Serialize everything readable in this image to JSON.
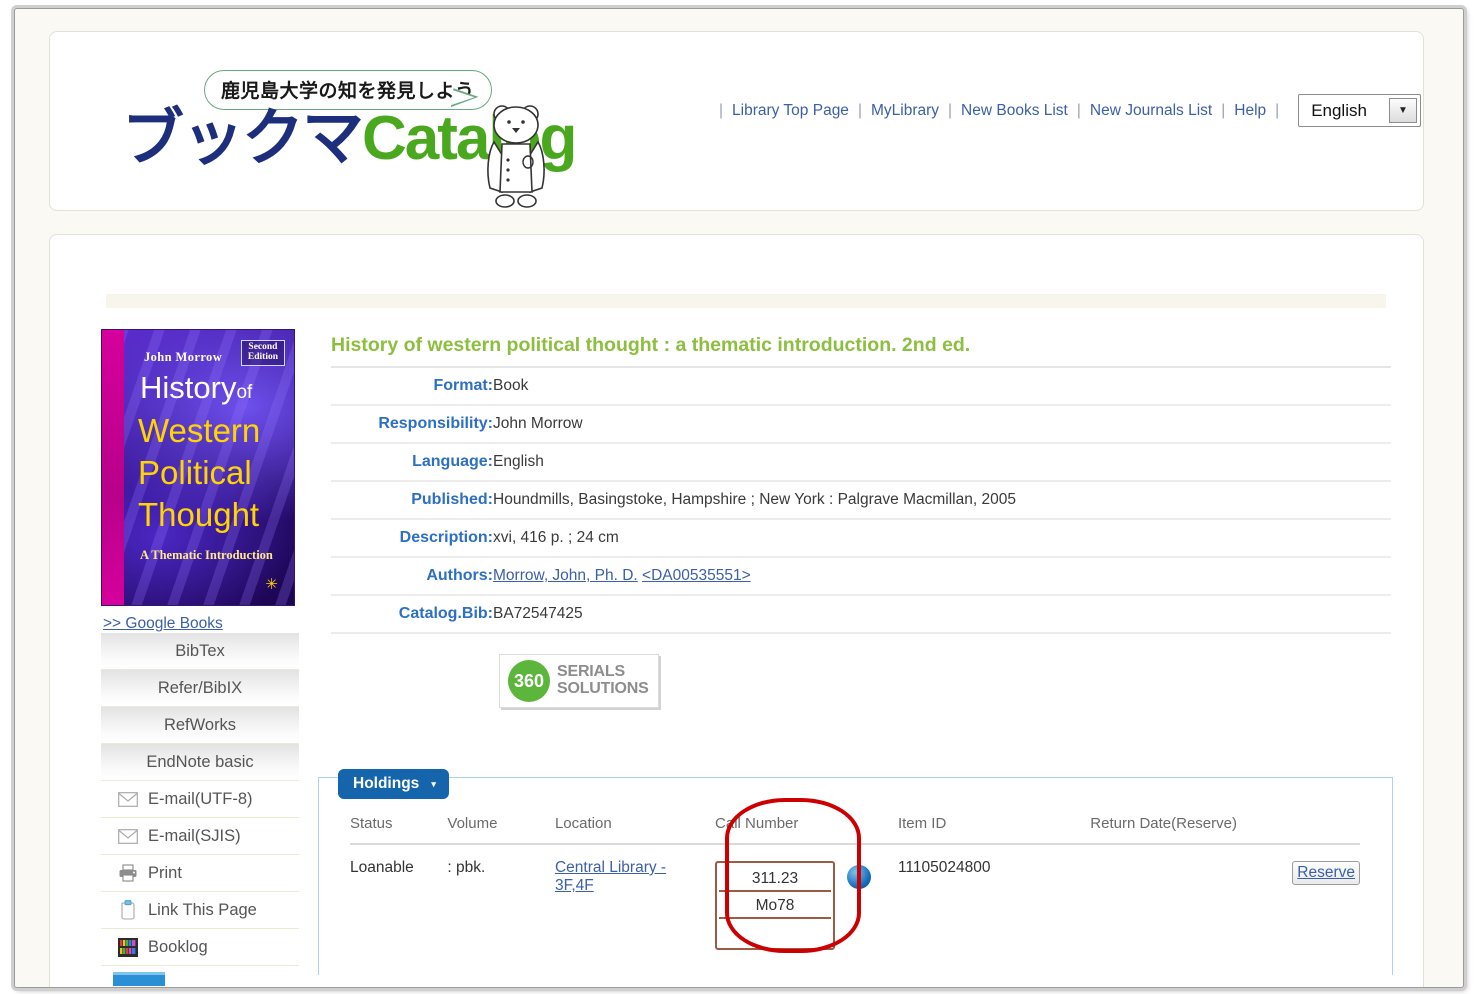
{
  "header": {
    "tagline": "鹿児島大学の知を発見しよう",
    "wordmark_jp": "ブックマ",
    "wordmark_en": "Catalog",
    "mascot_icon": "bear-mascot-icon",
    "nav": [
      {
        "label": "Library Top Page"
      },
      {
        "label": "MyLibrary"
      },
      {
        "label": "New Books List"
      },
      {
        "label": "New Journals List"
      },
      {
        "label": "Help"
      }
    ],
    "separator": "|",
    "language": {
      "selected": "English",
      "caret": "▼"
    }
  },
  "sidebar": {
    "cover": {
      "author": "John Morrow",
      "edition_line1": "Second",
      "edition_line2": "Edition",
      "title_main": "History",
      "title_of": "of",
      "title_l1": "Western",
      "title_l2": "Political",
      "title_l3": "Thought",
      "subtitle": "A Thematic Introduction",
      "publisher_mark": "✳"
    },
    "google_books_label": ">> Google Books",
    "export_buttons": [
      {
        "label": "BibTex"
      },
      {
        "label": "Refer/BibIX"
      },
      {
        "label": "RefWorks"
      },
      {
        "label": "EndNote basic"
      }
    ],
    "action_rows": [
      {
        "label": "E-mail(UTF-8)",
        "icon": "envelope-icon"
      },
      {
        "label": "E-mail(SJIS)",
        "icon": "envelope-icon"
      },
      {
        "label": "Print",
        "icon": "printer-icon"
      },
      {
        "label": "Link This Page",
        "icon": "clipboard-link-icon"
      },
      {
        "label": "Booklog",
        "icon": "bookshelf-icon"
      }
    ]
  },
  "record": {
    "title": "History of western political thought : a thematic introduction. 2nd ed.",
    "fields": [
      {
        "label": "Format:",
        "value": "Book",
        "link": false
      },
      {
        "label": "Responsibility:",
        "value": "John Morrow",
        "link": false
      },
      {
        "label": "Language:",
        "value": "English",
        "link": false
      },
      {
        "label": "Published:",
        "value": "Houndmills, Basingstoke, Hampshire ; New York : Palgrave Macmillan, 2005",
        "link": false
      },
      {
        "label": "Description:",
        "value": "xvi, 416 p. ; 24 cm",
        "link": false
      },
      {
        "label": "Authors:",
        "value": "Morrow, John, Ph. D.",
        "value2": "<DA00535551>",
        "link": true
      },
      {
        "label": "Catalog.Bib:",
        "value": "BA72547425",
        "link": false
      }
    ],
    "serials_logo": {
      "badge": "360",
      "line1": "SERIALS",
      "line2": "SOLUTIONS"
    }
  },
  "holdings": {
    "tab_label": "Holdings",
    "tab_caret": "▾",
    "columns": [
      "Status",
      "Volume",
      "Location",
      "Call Number",
      "Item ID",
      "Return Date(Reserve)"
    ],
    "rows": [
      {
        "status": "Loanable",
        "volume": ": pbk.",
        "location_line1": "Central Library -",
        "location_line2": "3F,4F",
        "call_number_lines": [
          "311.23",
          "Mo78",
          ""
        ],
        "info_icon": "info-icon",
        "info_glyph": "i",
        "item_id": "11105024800",
        "return_date": "",
        "reserve_label": "Reserve"
      }
    ]
  },
  "annotation": {
    "shape": "red-oval-highlight",
    "color": "#cc0000",
    "target": "call-number-column"
  },
  "colors": {
    "brand_green": "#4aa81e",
    "brand_navy": "#1d2f7c",
    "title_green": "#8cbf3f",
    "label_blue": "#2d6fc4",
    "link_blue": "#3b5fa8",
    "tab_blue": "#1565ad",
    "annotation_red": "#cc0000",
    "callbox_brown": "#9b5b44"
  }
}
